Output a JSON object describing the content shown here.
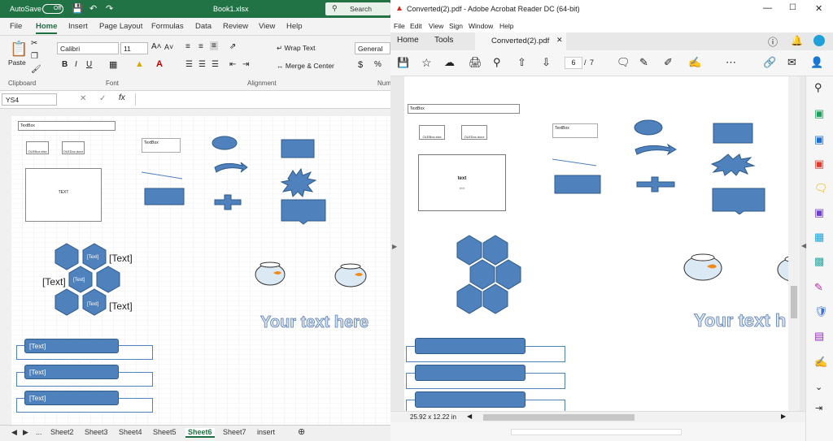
{
  "excel": {
    "autosave_label": "AutoSave",
    "autosave_state": "Off",
    "file_title": "Book1.xlsx",
    "search_placeholder": "Search",
    "ribbon_tabs": [
      "File",
      "Home",
      "Insert",
      "Page Layout",
      "Formulas",
      "Data",
      "Review",
      "View",
      "Help"
    ],
    "paste_label": "Paste",
    "font_name": "Calibri",
    "font_size": "11",
    "wrap_text": "Wrap Text",
    "merge_center": "Merge & Center",
    "number_format": "General",
    "dollar": "$",
    "num_group": "Num",
    "groups": {
      "clipboard": "Clipboard",
      "font": "Font",
      "alignment": "Alignment"
    },
    "name_box": "YS4",
    "fx": "fx",
    "grid_content": {
      "textbox": "TextBox",
      "obj1": "OLEBox.xlsx",
      "obj2": "OLEDoc.docx",
      "box_text": "TEXT",
      "text_labels": [
        "[Text]",
        "[Text]",
        "[Text]",
        "[Text]",
        "[Text]"
      ],
      "list_labels": [
        "[Text]",
        "[Text]",
        "[Text]"
      ],
      "wordart": "Your text here",
      "textbox2": "TextBox"
    },
    "sheets": [
      "Sheet2",
      "Sheet3",
      "Sheet4",
      "Sheet5",
      "Sheet6",
      "Sheet7",
      "insert"
    ],
    "active_sheet": "Sheet6",
    "ellipsis": "..."
  },
  "acrobat": {
    "title": "Converted(2).pdf - Adobe Acrobat Reader DC (64-bit)",
    "menu": [
      "File",
      "Edit",
      "View",
      "Sign",
      "Window",
      "Help"
    ],
    "tabs": {
      "home": "Home",
      "tools": "Tools",
      "doc": "Converted(2).pdf"
    },
    "page_current": "6",
    "page_sep": "/",
    "page_total": "7",
    "page_content": {
      "textbox": "TextBox",
      "obj1": "OLEBox.xlsx",
      "obj2": "OLEDoc.docx",
      "box_text": "text",
      "box_sub": "text",
      "textbox2": "TextBox",
      "wordart": "Your text h"
    },
    "page_size": "25.92 x 12.22 in"
  },
  "colors": {
    "excel_green": "#217346",
    "shape_blue": "#4f81bd"
  }
}
